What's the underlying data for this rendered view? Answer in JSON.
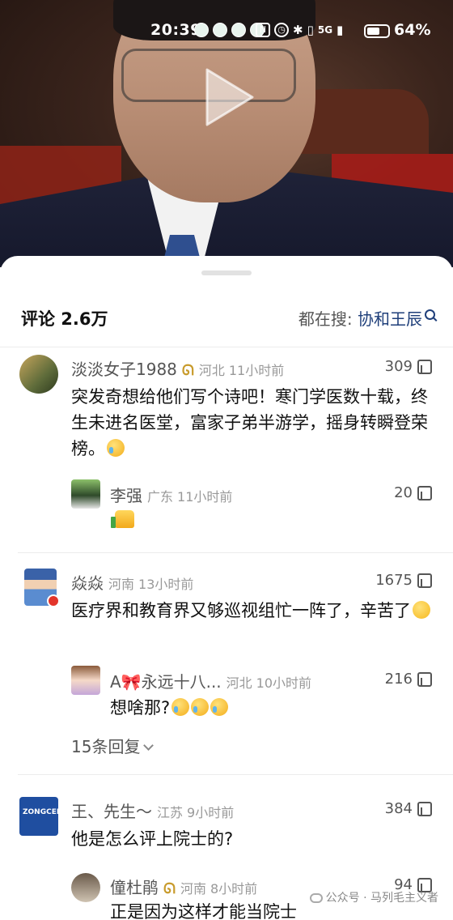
{
  "status_bar": {
    "time": "20:39",
    "network": "5G",
    "battery_pct": "64%",
    "battery_level": 0.64
  },
  "video": {
    "play_icon": "play-icon"
  },
  "sheet": {
    "comments_title": "评论 2.6万",
    "hot_search_label": "都在搜: ",
    "hot_search_term": "协和王辰"
  },
  "comments": [
    {
      "user": "淡淡女子1988",
      "badge": "ὦ",
      "location": "河北",
      "time": "11小时前",
      "likes": "309",
      "text": "突发奇想给他们写个诗吧！寒门学医数十载，终生未进名医堂，富家子弟半游学，摇身转瞬登荣榜。",
      "reply": {
        "user": "李强",
        "location": "广东",
        "time": "11小时前",
        "likes": "20"
      }
    },
    {
      "user": "焱焱",
      "location": "河南",
      "time": "13小时前",
      "likes": "1675",
      "text": "医疗界和教育界又够巡视组忙一阵了，辛苦了",
      "reply": {
        "user": "A🎀永远十八...",
        "location": "河北",
        "time": "10小时前",
        "likes": "216",
        "text": "想啥那?"
      },
      "more_replies": "15条回复"
    },
    {
      "user": "王、先生～",
      "location": "江苏",
      "time": "9小时前",
      "likes": "384",
      "text": "他是怎么评上院士的?",
      "reply": {
        "user": "僮杜鹃",
        "location": "河南",
        "time": "8小时前",
        "likes": "94",
        "text": "正是因为这样才能当院士"
      }
    }
  ],
  "watermark": "公众号 · 马列毛主义者"
}
